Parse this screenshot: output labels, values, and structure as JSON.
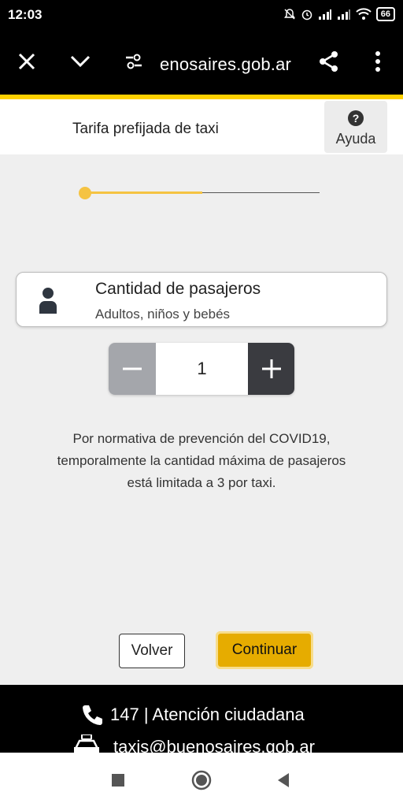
{
  "status_bar": {
    "time": "12:03",
    "battery": "66"
  },
  "browser": {
    "url": "enosaires.gob.ar"
  },
  "header": {
    "title": "Tarifa prefijada de taxi",
    "help_label": "Ayuda",
    "help_icon": "?"
  },
  "progress": {
    "fraction": 0.5
  },
  "passengers": {
    "title": "Cantidad de pasajeros",
    "subtitle": "Adultos, niños y bebés",
    "value": "1"
  },
  "notice": {
    "line1": "Por normativa de prevención del COVID19,",
    "line2": "temporalmente la cantidad máxima de pasajeros",
    "line3": "está limitada a 3 por taxi."
  },
  "actions": {
    "back_label": "Volver",
    "continue_label": "Continuar"
  },
  "footer": {
    "phone": "147 | Atención ciudadana",
    "email": "taxis@buenosaires.gob.ar"
  },
  "colors": {
    "accent": "#ffd100",
    "progress": "#f5c342",
    "primary_button": "#e6ac00"
  },
  "icons": [
    "close-icon",
    "chevron-down-icon",
    "site-settings-icon",
    "share-icon",
    "more-icon",
    "help-icon",
    "person-icon",
    "minus-icon",
    "plus-icon",
    "phone-icon",
    "taxi-icon",
    "recents-icon",
    "home-icon",
    "back-icon"
  ]
}
